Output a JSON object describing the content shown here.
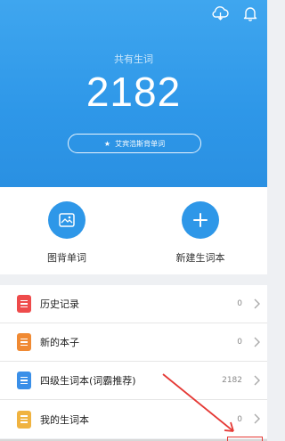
{
  "header": {
    "label": "共有生词",
    "count": "2182",
    "pill_text": "艾宾浩斯背单词"
  },
  "actions": [
    {
      "label": "图背单词",
      "icon": "picture-card-icon"
    },
    {
      "label": "新建生词本",
      "icon": "plus-icon"
    }
  ],
  "list": [
    {
      "title": "历史记录",
      "count": "0",
      "color": "#ee4b4b"
    },
    {
      "title": "新的本子",
      "count": "0",
      "color": "#f08a33"
    },
    {
      "title": "四级生词本(词霸推荐)",
      "count": "2182",
      "color": "#3a8fe8"
    },
    {
      "title": "我的生词本",
      "count": "0",
      "color": "#f0b340"
    }
  ],
  "colors": {
    "accent": "#2e97e8",
    "annotation": "#e53935"
  }
}
